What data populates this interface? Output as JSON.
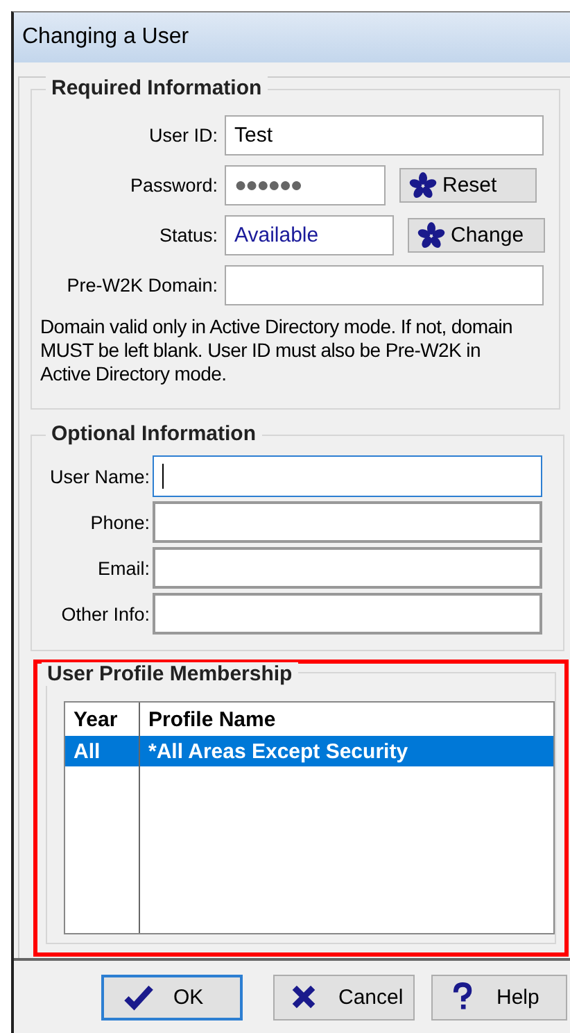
{
  "window": {
    "title": "Changing a User"
  },
  "required": {
    "title": "Required Information",
    "fields": [
      {
        "kind": "text",
        "label": "User ID:",
        "value": "Test"
      },
      {
        "kind": "password",
        "label": "Password:",
        "value": "●●●●●●",
        "button": "Reset"
      },
      {
        "kind": "status",
        "label": "Status:",
        "value": "Available",
        "button": "Change"
      },
      {
        "kind": "text",
        "label": "Pre-W2K Domain:"
      }
    ],
    "note": "Domain valid only in Active Directory mode. If not, domain MUST be left blank. User ID must also be Pre-W2K in Active Directory mode."
  },
  "optional": {
    "title": "Optional Information",
    "fields": [
      {
        "label": "User Name:",
        "focused": true
      },
      {
        "label": "Phone:",
        "focused": false
      },
      {
        "label": "Email:",
        "focused": false
      },
      {
        "label": "Other Info:",
        "focused": false
      }
    ]
  },
  "membership": {
    "title": "User Profile Membership",
    "highlighted": true,
    "table": {
      "columns": [
        "Year",
        "Profile Name"
      ],
      "rows": [
        {
          "cells": [
            "All",
            "*All Areas Except Security"
          ],
          "selected": true
        }
      ]
    }
  },
  "buttons": [
    {
      "kind": "ok",
      "label": "OK",
      "focused": true
    },
    {
      "kind": "cancel",
      "label": "Cancel",
      "focused": false
    },
    {
      "kind": "help",
      "label": "Help",
      "focused": false
    }
  ]
}
